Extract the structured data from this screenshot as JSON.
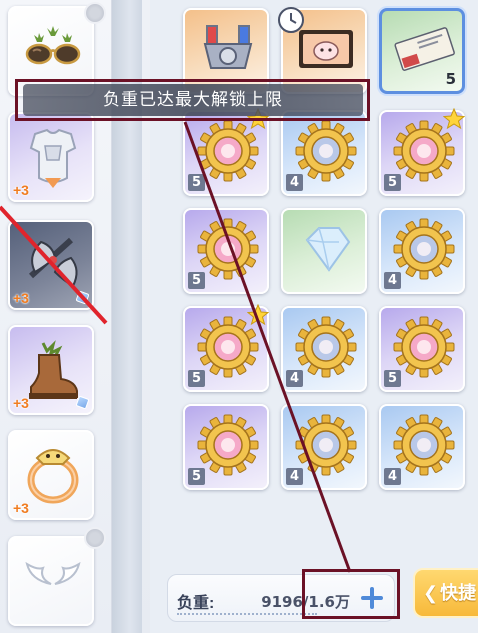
{
  "toast": {
    "message": "负重已达最大解锁上限"
  },
  "equipment_slots": [
    {
      "name": "sunglasses",
      "refine": ""
    },
    {
      "name": "armor",
      "refine": "+3"
    },
    {
      "name": "axe",
      "refine": "+3"
    },
    {
      "name": "boots",
      "refine": "+3"
    },
    {
      "name": "ring",
      "refine": "+3"
    },
    {
      "name": "wings",
      "refine": ""
    }
  ],
  "inventory": {
    "row1": [
      {
        "name": "potion-machine",
        "badge": "",
        "count": ""
      },
      {
        "name": "card-ticket",
        "badge": "",
        "count": ""
      },
      {
        "name": "voucher-ticket",
        "badge": "",
        "count": "5"
      }
    ],
    "row2": [
      {
        "badge": "5"
      },
      {
        "badge": "4"
      },
      {
        "badge": "5"
      }
    ],
    "row3": [
      {
        "badge": "5"
      },
      {
        "badge": ""
      },
      {
        "badge": "4"
      }
    ],
    "row4": [
      {
        "badge": "5"
      },
      {
        "badge": "4"
      },
      {
        "badge": "5"
      }
    ],
    "row5": [
      {
        "badge": "5"
      },
      {
        "badge": "4"
      },
      {
        "badge": "4"
      }
    ]
  },
  "weight": {
    "label": "负重:",
    "value": "9196/1.6万"
  },
  "quick_button": {
    "label": "快捷"
  },
  "colors": {
    "annotation": "#6b1126",
    "accent": "#5d8fe0",
    "refine": "#f07d22",
    "quick_button": "#f7b93a"
  }
}
